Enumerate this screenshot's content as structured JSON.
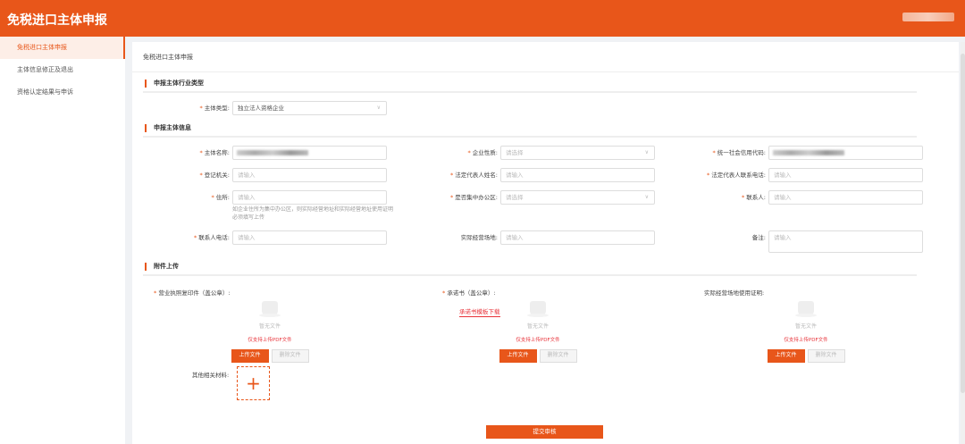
{
  "header": {
    "title": "免税进口主体申报"
  },
  "sidebar": {
    "items": [
      {
        "label": "免税进口主体申报"
      },
      {
        "label": "主体信息修正及退出"
      },
      {
        "label": "资格认定结果与申诉"
      }
    ]
  },
  "card": {
    "title": "免税进口主体申报"
  },
  "sections": {
    "industry": "申报主体行业类型",
    "info": "申报主体信息",
    "attach": "附件上传"
  },
  "form": {
    "subject_type": {
      "label": "主体类型:",
      "value": "独立法人资格企业"
    },
    "name": {
      "label": "主体名称:"
    },
    "enterprise_nature": {
      "label": "企业性质:",
      "placeholder": "请选择"
    },
    "credit_code": {
      "label": "统一社会信用代码:"
    },
    "reg_authority": {
      "label": "登记机关:",
      "placeholder": "请输入"
    },
    "legal_rep_name": {
      "label": "法定代表人姓名:",
      "placeholder": "请输入"
    },
    "legal_rep_phone": {
      "label": "法定代表人联系电话:",
      "placeholder": "请输入"
    },
    "address": {
      "label": "住所:",
      "placeholder": "请输入",
      "hint": "如企业住所为集中办公区，则实际经营地址和实际经营地址使用证明必须填写上传"
    },
    "central_office": {
      "label": "是否集中办公区:",
      "placeholder": "请选择"
    },
    "contact": {
      "label": "联系人:",
      "placeholder": "请输入"
    },
    "contact_phone": {
      "label": "联系人电话:",
      "placeholder": "请输入"
    },
    "actual_address": {
      "label": "实际经营场地:",
      "placeholder": "请输入"
    },
    "remark": {
      "label": "备注:",
      "placeholder": "请输入"
    }
  },
  "uploads": {
    "items": [
      {
        "label": "营业执照复印件（盖公章）:"
      },
      {
        "label": "承诺书（盖公章）:"
      },
      {
        "label": "实际经营场地使用证明:"
      }
    ],
    "empty": "暂无文件",
    "hint": "仅支持上传PDF文件",
    "upload": "上传文件",
    "delete": "删除文件",
    "template_link": "承诺书模板下载",
    "other_label": "其他相关材料:",
    "plus": "+"
  },
  "submit": "提交审核"
}
